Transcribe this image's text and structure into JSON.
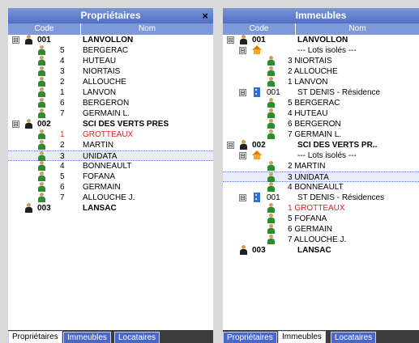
{
  "left": {
    "title": "Propriétaires",
    "close_label": "×",
    "col_code": "Code",
    "col_nom": "Nom",
    "tabs": [
      "Propriétaires",
      "Immeubles",
      "Locataires"
    ],
    "rows": [
      {
        "type": "owner",
        "toggle": "⊟",
        "code": "001",
        "name": "LANVOLLON"
      },
      {
        "type": "tenant",
        "num": "5",
        "name": "BERGERAC"
      },
      {
        "type": "tenant",
        "num": "4",
        "name": "HUTEAU"
      },
      {
        "type": "tenant",
        "num": "3",
        "name": "NIORTAIS"
      },
      {
        "type": "tenant",
        "num": "2",
        "name": "ALLOUCHE"
      },
      {
        "type": "tenant",
        "num": "1",
        "name": "LANVON"
      },
      {
        "type": "tenant",
        "num": "6",
        "name": "BERGERON"
      },
      {
        "type": "tenant",
        "num": "7",
        "name": "GERMAIN L."
      },
      {
        "type": "owner",
        "toggle": "⊟",
        "code": "002",
        "name": "SCI DES VERTS PRES"
      },
      {
        "type": "tenant",
        "num": "1",
        "name": "GROTTEAUX",
        "red": true
      },
      {
        "type": "tenant",
        "num": "2",
        "name": "MARTIN"
      },
      {
        "type": "tenant",
        "num": "3",
        "name": "UNIDATA",
        "selected": true
      },
      {
        "type": "tenant",
        "num": "4",
        "name": "BONNEAULT"
      },
      {
        "type": "tenant",
        "num": "5",
        "name": "FOFANA"
      },
      {
        "type": "tenant",
        "num": "6",
        "name": "GERMAIN"
      },
      {
        "type": "tenant",
        "num": "7",
        "name": "ALLOUCHE J."
      },
      {
        "type": "owner",
        "toggle": "",
        "code": "003",
        "name": "LANSAC"
      }
    ]
  },
  "right": {
    "title": "Immeubles",
    "col_code": "Code",
    "col_nom": "Nom",
    "tabs": [
      "Propriétaires",
      "Immeubles",
      "Locataires"
    ],
    "rows": [
      {
        "type": "owner",
        "toggle": "⊟",
        "code": "001",
        "name": "LANVOLLON"
      },
      {
        "type": "lots",
        "toggle": "⊟",
        "name": "--- Lots isolés ---"
      },
      {
        "type": "tenant",
        "name": "3 NIORTAIS"
      },
      {
        "type": "tenant",
        "name": "2 ALLOUCHE"
      },
      {
        "type": "tenant",
        "name": "1 LANVON"
      },
      {
        "type": "building",
        "toggle": "⊟",
        "code": "001",
        "name": "ST DENIS - Résidence"
      },
      {
        "type": "tenant",
        "name": "5 BERGERAC"
      },
      {
        "type": "tenant",
        "name": "4 HUTEAU"
      },
      {
        "type": "tenant",
        "name": "6 BERGERON"
      },
      {
        "type": "tenant",
        "name": "7 GERMAIN L."
      },
      {
        "type": "owner",
        "toggle": "⊟",
        "code": "002",
        "name": "SCI DES VERTS PR.."
      },
      {
        "type": "lots",
        "toggle": "⊟",
        "name": "--- Lots isolés ---"
      },
      {
        "type": "tenant",
        "name": "2 MARTIN"
      },
      {
        "type": "tenant",
        "name": "3 UNIDATA",
        "selected": true
      },
      {
        "type": "tenant",
        "name": "4 BONNEAULT"
      },
      {
        "type": "building",
        "toggle": "⊟",
        "code": "001",
        "name": "ST DENIS - Résidences"
      },
      {
        "type": "tenant",
        "name": "1 GROTTEAUX",
        "red": true
      },
      {
        "type": "tenant",
        "name": "5 FOFANA"
      },
      {
        "type": "tenant",
        "name": "6 GERMAIN"
      },
      {
        "type": "tenant",
        "name": "7 ALLOUCHE J."
      },
      {
        "type": "owner",
        "toggle": "",
        "code": "003",
        "name": "LANSAC"
      }
    ]
  }
}
